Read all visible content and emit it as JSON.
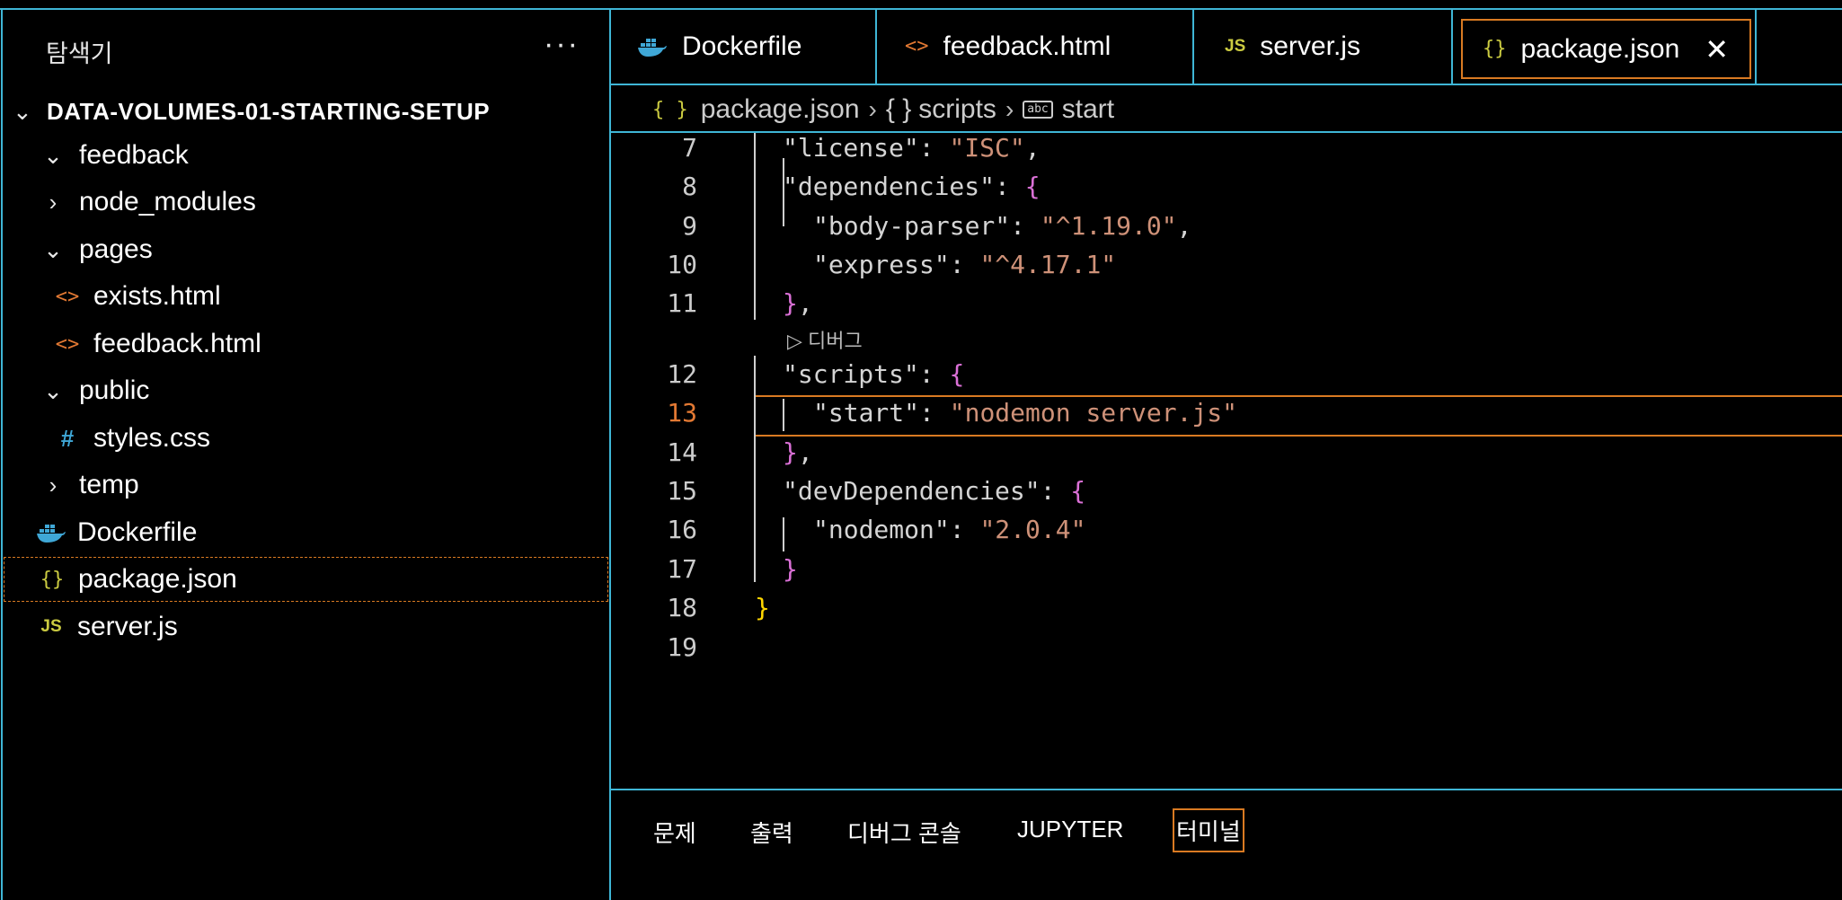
{
  "sidebar": {
    "title": "탐색기",
    "more": "···",
    "root": "DATA-VOLUMES-01-STARTING-SETUP",
    "items": [
      {
        "label": "feedback",
        "icon": "chevron-down"
      },
      {
        "label": "node_modules",
        "icon": "chevron-right"
      },
      {
        "label": "pages",
        "icon": "chevron-down"
      },
      {
        "label": "exists.html",
        "icon": "html"
      },
      {
        "label": "feedback.html",
        "icon": "html"
      },
      {
        "label": "public",
        "icon": "chevron-down"
      },
      {
        "label": "styles.css",
        "icon": "css"
      },
      {
        "label": "temp",
        "icon": "chevron-right"
      },
      {
        "label": "Dockerfile",
        "icon": "docker"
      },
      {
        "label": "package.json",
        "icon": "json"
      },
      {
        "label": "server.js",
        "icon": "js"
      }
    ]
  },
  "tabs": [
    {
      "label": "Dockerfile",
      "icon": "docker"
    },
    {
      "label": "feedback.html",
      "icon": "html"
    },
    {
      "label": "server.js",
      "icon": "js"
    },
    {
      "label": "package.json",
      "icon": "json",
      "active": true
    }
  ],
  "breadcrumb": {
    "file": "package.json",
    "section": "scripts",
    "key": "start",
    "section_icon": "{ }",
    "file_icon": "{ }"
  },
  "editor": {
    "line_numbers": [
      "7",
      "8",
      "9",
      "10",
      "11",
      "12",
      "13",
      "14",
      "15",
      "16",
      "17",
      "18",
      "19"
    ],
    "current_line": "13",
    "codelens": "디버그",
    "lines": {
      "l7_key": "\"license\"",
      "l7_val": "\"ISC\"",
      "l8_key": "\"dependencies\"",
      "l9_key": "\"body-parser\"",
      "l9_val": "\"^1.19.0\"",
      "l10_key": "\"express\"",
      "l10_val": "\"^4.17.1\"",
      "l12_key": "\"scripts\"",
      "l13_key": "\"start\"",
      "l13_val": "\"nodemon server.js\"",
      "l15_key": "\"devDependencies\"",
      "l16_key": "\"nodemon\"",
      "l16_val": "\"2.0.4\""
    }
  },
  "panel": {
    "tabs": [
      "문제",
      "출력",
      "디버그 콘솔",
      "JUPYTER",
      "터미널"
    ],
    "active": "터미널"
  },
  "colors": {
    "accent": "#d97a22",
    "border": "#3fb6d6",
    "string": "#ce9178",
    "brace": "#da70d6",
    "line_number_current": "#e37933"
  }
}
